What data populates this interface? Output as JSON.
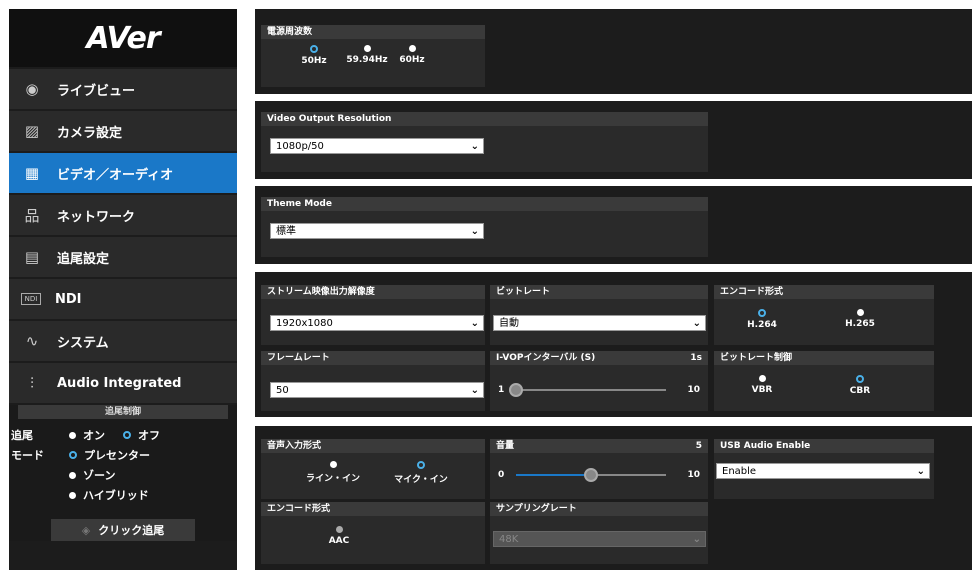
{
  "sidebar": {
    "logo": "AVer",
    "items": [
      {
        "label": "ライブビュー",
        "icon": "eye-icon",
        "glyph": "◉"
      },
      {
        "label": "カメラ設定",
        "icon": "image-icon",
        "glyph": "▨"
      },
      {
        "label": "ビデオ／オーディオ",
        "icon": "video-audio-icon",
        "glyph": "▦"
      },
      {
        "label": "ネットワーク",
        "icon": "network-icon",
        "glyph": "品"
      },
      {
        "label": "追尾設定",
        "icon": "tracking-settings-icon",
        "glyph": "▤"
      },
      {
        "label": "NDI",
        "icon": "ndi-icon",
        "glyph": "NDI"
      },
      {
        "label": "システム",
        "icon": "pulse-icon",
        "glyph": "∿"
      },
      {
        "label": "Audio Integrated",
        "icon": "audio-bars-icon",
        "glyph": "⫶"
      }
    ],
    "active_index": 2,
    "tracking": {
      "header": "追尾制御",
      "tracking_label": "追尾",
      "on": "オン",
      "off": "オフ",
      "mode_label": "モード",
      "presenter": "プレセンター",
      "zone": "ゾーン",
      "hybrid": "ハイブリッド",
      "click_button": "クリック追尾"
    }
  },
  "power_freq": {
    "title": "電源周波数",
    "options": [
      "50Hz",
      "59.94Hz",
      "60Hz"
    ],
    "selected": "50Hz"
  },
  "video_output": {
    "title": "Video Output Resolution",
    "value": "1080p/50"
  },
  "theme": {
    "title": "Theme Mode",
    "value": "標準"
  },
  "stream": {
    "resolution_title": "ストリーム映像出力解像度",
    "resolution_value": "1920x1080",
    "bitrate_title": "ビットレート",
    "bitrate_value": "自動",
    "encode_title": "エンコード形式",
    "encode_options": [
      "H.264",
      "H.265"
    ],
    "encode_selected": "H.264",
    "framerate_title": "フレームレート",
    "framerate_value": "50",
    "ivop_title": "I-VOPインターバル (S)",
    "ivop_value": "1s",
    "ivop_min": "1",
    "ivop_max": "10",
    "ivop_level": 0.0,
    "ratecontrol_title": "ビットレート制御",
    "ratecontrol_options": [
      "VBR",
      "CBR"
    ],
    "ratecontrol_selected": "CBR"
  },
  "audio": {
    "input_title": "音声入力形式",
    "input_options": [
      "ライン・イン",
      "マイク・イン"
    ],
    "input_selected": "マイク・イン",
    "volume_title": "音量",
    "volume_value": "5",
    "volume_min": "0",
    "volume_max": "10",
    "volume_level": 0.5,
    "usb_title": "USB Audio Enable",
    "usb_value": "Enable",
    "encode_title": "エンコード形式",
    "encode_value": "AAC",
    "sampling_title": "サンプリングレート",
    "sampling_value": "48K"
  },
  "colors": {
    "accent": "#1a78c8",
    "radio_off_ring": "#4ab0e8",
    "panel": "#1c1c1c"
  }
}
